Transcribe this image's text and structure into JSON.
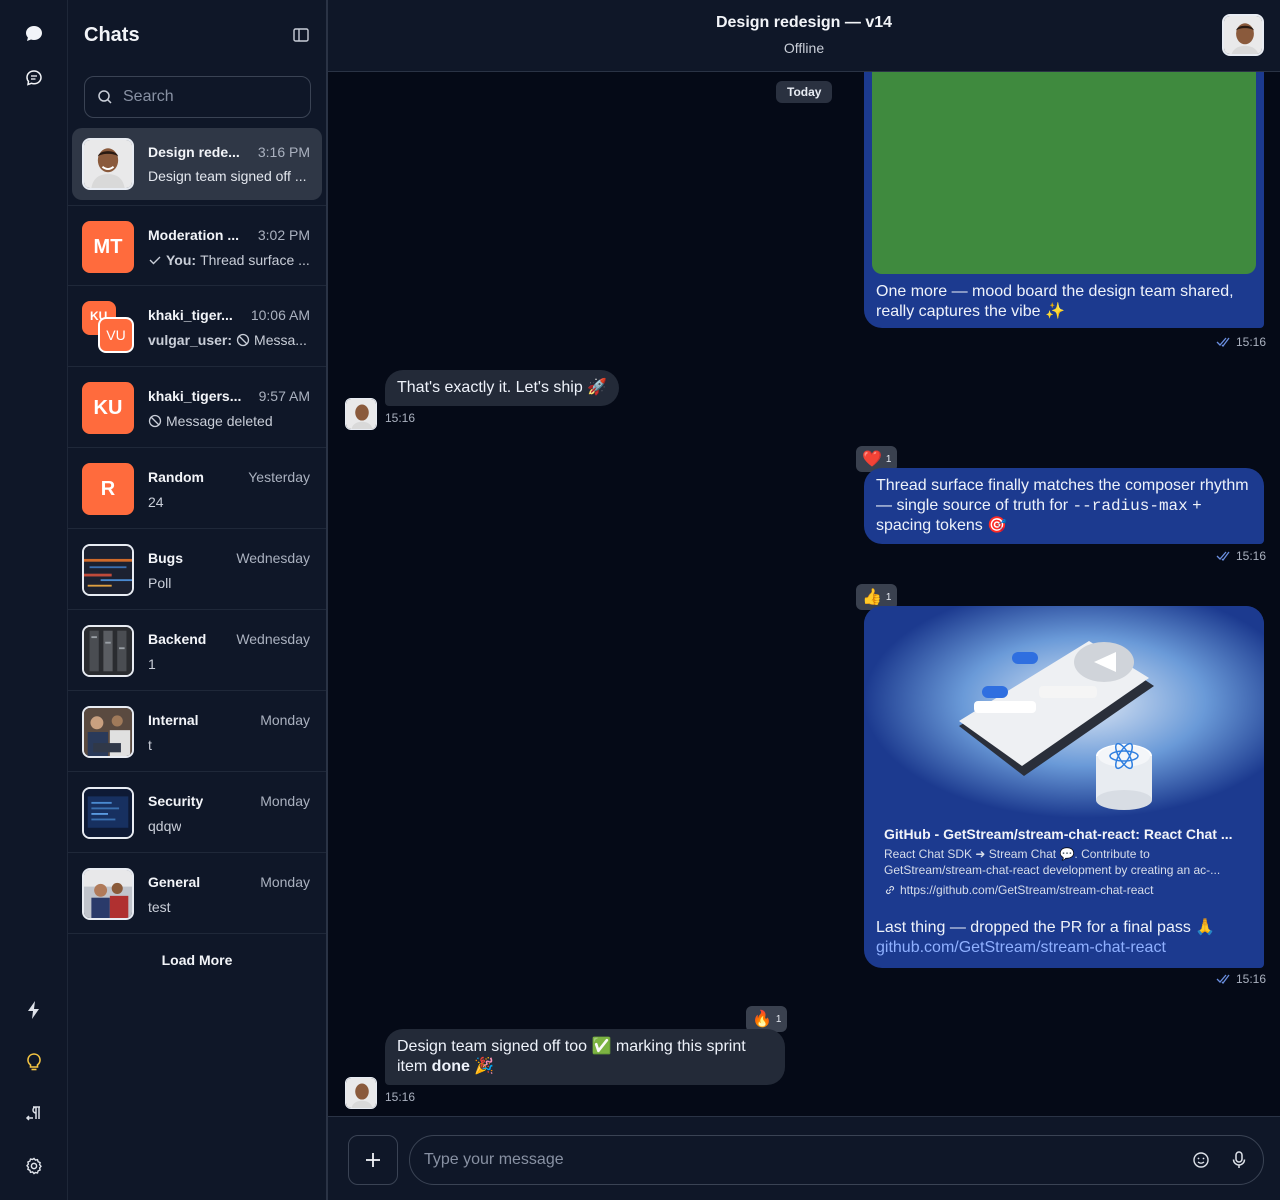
{
  "sidebar": {
    "title": "Chats",
    "search_placeholder": "Search",
    "load_more": "Load More",
    "items": [
      {
        "name": "Design rede...",
        "time": "3:16 PM",
        "preview": "Design team signed off ...",
        "avatar": "photo"
      },
      {
        "name": "Moderation ...",
        "time": "3:02 PM",
        "preview_prefix": "You:",
        "preview": "Thread surface ...",
        "initials": "MT"
      },
      {
        "name": "khaki_tiger...",
        "time": "10:06 AM",
        "preview_prefix": "vulgar_user:",
        "preview": "Messa...",
        "initials_a": "KU",
        "initials_b": "VU"
      },
      {
        "name": "khaki_tigers...",
        "time": "9:57 AM",
        "preview": "Message deleted",
        "initials": "KU"
      },
      {
        "name": "Random",
        "time": "Yesterday",
        "preview": "24",
        "initials": "R"
      },
      {
        "name": "Bugs",
        "time": "Wednesday",
        "preview": "Poll"
      },
      {
        "name": "Backend",
        "time": "Wednesday",
        "preview": "1"
      },
      {
        "name": "Internal",
        "time": "Monday",
        "preview": "t"
      },
      {
        "name": "Security",
        "time": "Monday",
        "preview": "qdqw"
      },
      {
        "name": "General",
        "time": "Monday",
        "preview": "test"
      }
    ]
  },
  "header": {
    "title": "Design redesign — v14",
    "subtitle": "Offline"
  },
  "messages": {
    "date": "Today",
    "m1": {
      "text": "One more — mood board the design team shared, really captures the vibe ✨",
      "time": "15:16"
    },
    "m2": {
      "text": "That's exactly it. Let's ship 🚀",
      "time": "15:16"
    },
    "m3": {
      "text_a": "Thread surface finally matches the composer rhythm — single source of truth for ",
      "code": "--radius-max",
      "text_b": " + spacing tokens 🎯",
      "time": "15:16",
      "reaction": "❤️",
      "reaction_count": "1"
    },
    "m4": {
      "reaction": "👍",
      "reaction_count": "1",
      "link_title": "GitHub - GetStream/stream-chat-react: React Chat ...",
      "link_desc": "React Chat SDK ➜ Stream Chat 💬. Contribute to GetStream/stream-chat-react development by creating an ac-...",
      "link_url": "https://github.com/GetStream/stream-chat-react",
      "text": "Last thing — dropped the PR for a final pass 🙏",
      "link_text": "github.com/GetStream/stream-chat-react",
      "time": "15:16"
    },
    "m5": {
      "text_a": "Design team signed off too ✅ marking this sprint item ",
      "bold": "done",
      "text_b": " 🎉",
      "time": "15:16",
      "reaction": "🔥",
      "reaction_count": "1"
    }
  },
  "composer": {
    "placeholder": "Type your message"
  },
  "colors": {
    "accent": "#1c3a8f",
    "orange": "#ff6b3d",
    "mood_board": "#3f8a3e",
    "bulb": "#f5c542"
  }
}
